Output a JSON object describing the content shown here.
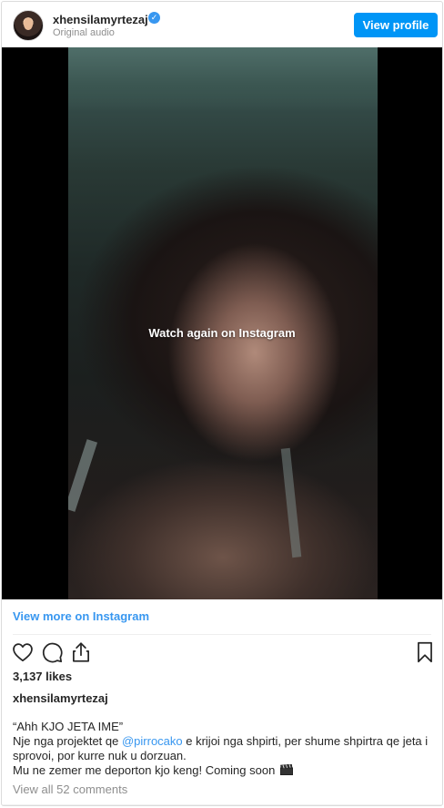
{
  "header": {
    "username": "xhensilamyrtezaj",
    "subtitle": "Original audio",
    "view_profile_label": "View profile"
  },
  "media": {
    "overlay_text": "Watch again on Instagram"
  },
  "links": {
    "view_more": "View more on Instagram"
  },
  "actions": {
    "icons": [
      "heart-icon",
      "comment-icon",
      "share-icon",
      "bookmark-icon"
    ]
  },
  "stats": {
    "likes": "3,137 likes"
  },
  "caption": {
    "username": "xhensilamyrtezaj",
    "line1": "“Ahh KJO JETA IME”",
    "line2_before": "Nje nga projektet qe ",
    "mention": "@pirrocako",
    "line2_after": " e krijoi nga shpirti, per shume shpirtra qe jeta i sprovoi, por kurre nuk u dorzuan.",
    "line3": "Mu ne zemer me deporton kjo keng! Coming soon"
  },
  "comments": {
    "view_all": "View all 52 comments"
  },
  "colors": {
    "accent": "#0095f6",
    "link": "#3897f0",
    "muted": "#8e8e8e",
    "text": "#262626"
  }
}
